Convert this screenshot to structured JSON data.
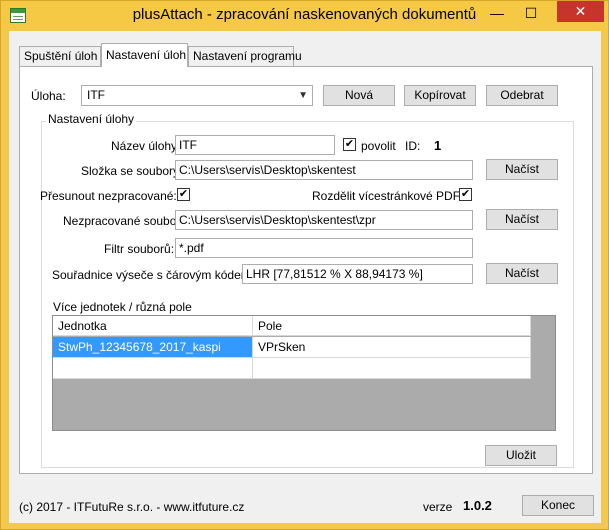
{
  "window": {
    "title": "plusAttach - zpracování naskenovaných dokumentů",
    "minimize_glyph": "—",
    "maximize_glyph": "☐",
    "close_glyph": "✕"
  },
  "tabs": [
    {
      "label": "Spuštění úloh"
    },
    {
      "label": "Nastavení úloh"
    },
    {
      "label": "Nastavení programu"
    }
  ],
  "task": {
    "label": "Úloha:",
    "selected": "ITF",
    "buttons": {
      "new": "Nová",
      "copy": "Kopírovat",
      "remove": "Odebrat"
    }
  },
  "settings": {
    "group_title": "Nastavení úlohy",
    "name_label": "Název úlohy:",
    "name_value": "ITF",
    "enabled_label": "povolit",
    "enabled_checked": "✔",
    "id_label": "ID:",
    "id_value": "1",
    "folder_label": "Složka se soubory:",
    "folder_value": "C:\\Users\\servis\\Desktop\\skentest",
    "load_label": "Načíst",
    "move_label": "Přesunout nezpracované:",
    "move_checked": "✔",
    "split_label": "Rozdělit vícestránkové PDF:",
    "split_checked": "✔",
    "unprocessed_label": "Nezpracované soubory:",
    "unprocessed_value": "C:\\Users\\servis\\Desktop\\skentest\\zpr",
    "filter_label": "Filtr souborů:",
    "filter_value": "*.pdf",
    "coords_label": "Souřadnice výseče s čárovým kódem:",
    "coords_value": "LHR [77,81512 % X 88,94173 %]",
    "multi_label": "Více jednotek / různá pole"
  },
  "grid": {
    "columns": [
      "Jednotka",
      "Pole"
    ],
    "rows": [
      [
        "StwPh_12345678_2017_kaspi",
        "VPrSken"
      ],
      [
        "",
        ""
      ]
    ]
  },
  "save_label": "Uložit",
  "footer": {
    "copyright": "(c) 2017 - ITFutuRe s.r.o.  - www.itfuture.cz",
    "version_label": "verze",
    "version_value": "1.0.2",
    "end_label": "Konec"
  }
}
